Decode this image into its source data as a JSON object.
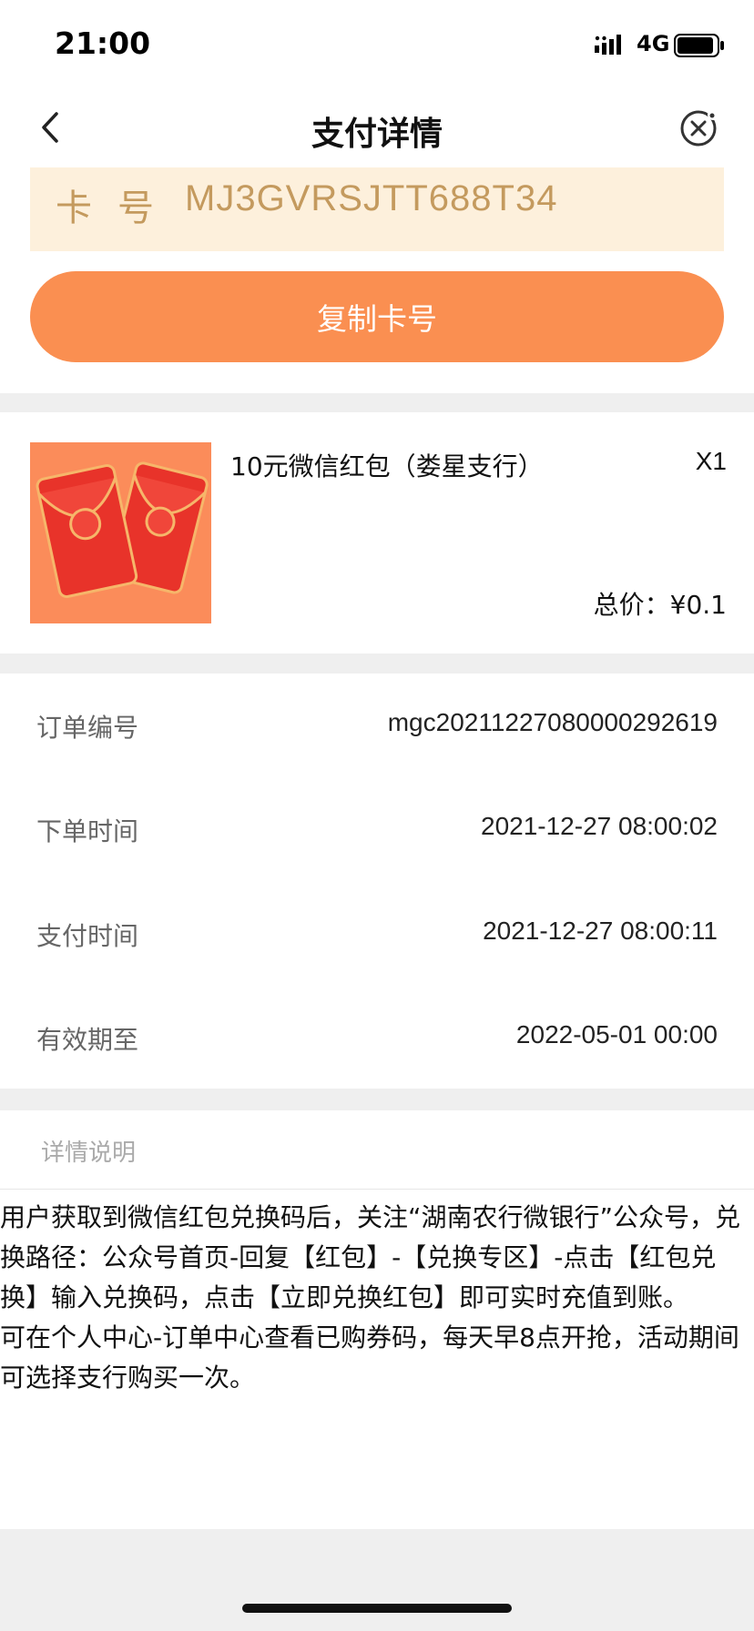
{
  "status_bar": {
    "time": "21:00",
    "network": "4G",
    "icons": [
      "signal-icon",
      "battery-icon"
    ]
  },
  "nav": {
    "title": "支付详情",
    "back_icon": "chevron-left-icon",
    "close_icon": "close-circle-icon"
  },
  "card": {
    "label": "卡号",
    "number": "MJ3GVRSJTT688T34",
    "copy_button_label": "复制卡号"
  },
  "product": {
    "image_icon": "red-envelope-icon",
    "name": "10元微信红包（娄星支行）",
    "quantity": "X1",
    "total": "总价：¥0.1"
  },
  "order_details": [
    {
      "label": "订单编号",
      "value": "mgc20211227080000292619"
    },
    {
      "label": "下单时间",
      "value": "2021-12-27 08:00:02"
    },
    {
      "label": "支付时间",
      "value": "2021-12-27 08:00:11"
    },
    {
      "label": "有效期至",
      "value": "2022-05-01 00:00"
    }
  ],
  "description": {
    "header": "详情说明",
    "paragraphs": [
      "用户获取到微信红包兑换码后，关注“湖南农行微银行”公众号，兑换路径：公众号首页-回复【红包】-【兑换专区】-点击【红包兑换】输入兑换码，点击【立即兑换红包】即可实时充值到账。",
      "可在个人中心-订单中心查看已购券码，每天早8点开抢，活动期间可选择支行购买一次。"
    ]
  },
  "colors": {
    "accent": "#fa8f51",
    "card_bg": "#fdf0dc",
    "card_text": "#c49a5e",
    "section_gap": "#efefef"
  }
}
